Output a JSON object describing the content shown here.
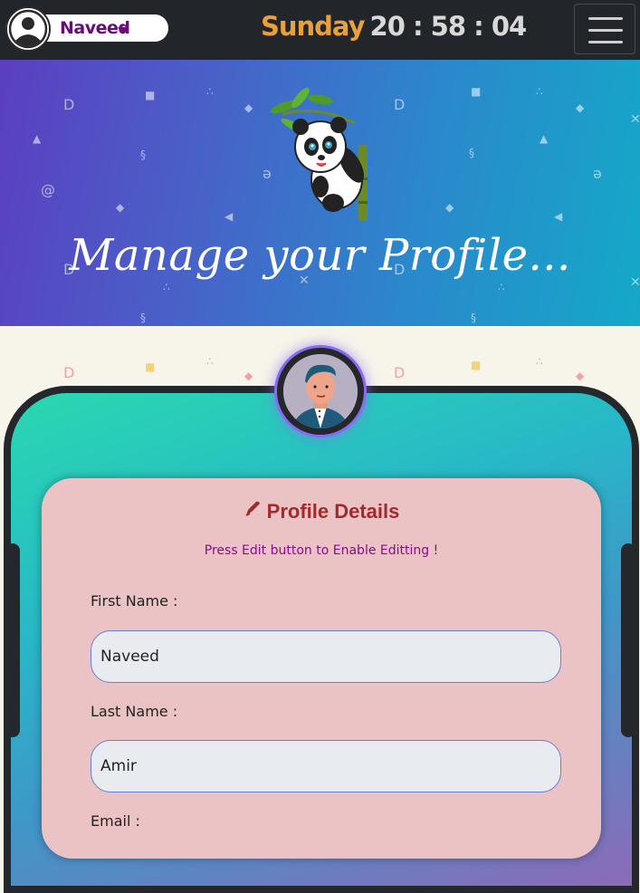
{
  "header": {
    "user_name": "Naveed",
    "day": "Sunday",
    "time": "20 : 58 : 04",
    "menu_icon": "hamburger-menu-icon"
  },
  "hero": {
    "title": "Manage your Profile..."
  },
  "profile": {
    "title": "Profile Details",
    "title_icon": "pen-icon",
    "note": "Press Edit button to Enable Editting !",
    "fields": [
      {
        "label": "First Name :",
        "value": "Naveed"
      },
      {
        "label": "Last Name :",
        "value": "Amir"
      },
      {
        "label": "Email :",
        "value": ""
      }
    ]
  },
  "colors": {
    "topbar": "#22252a",
    "user_name": "#6b0a7a",
    "day": "#e8a13a",
    "card": "#ebc3c5",
    "card_title": "#a32a2a",
    "note": "#8a0c8a"
  }
}
